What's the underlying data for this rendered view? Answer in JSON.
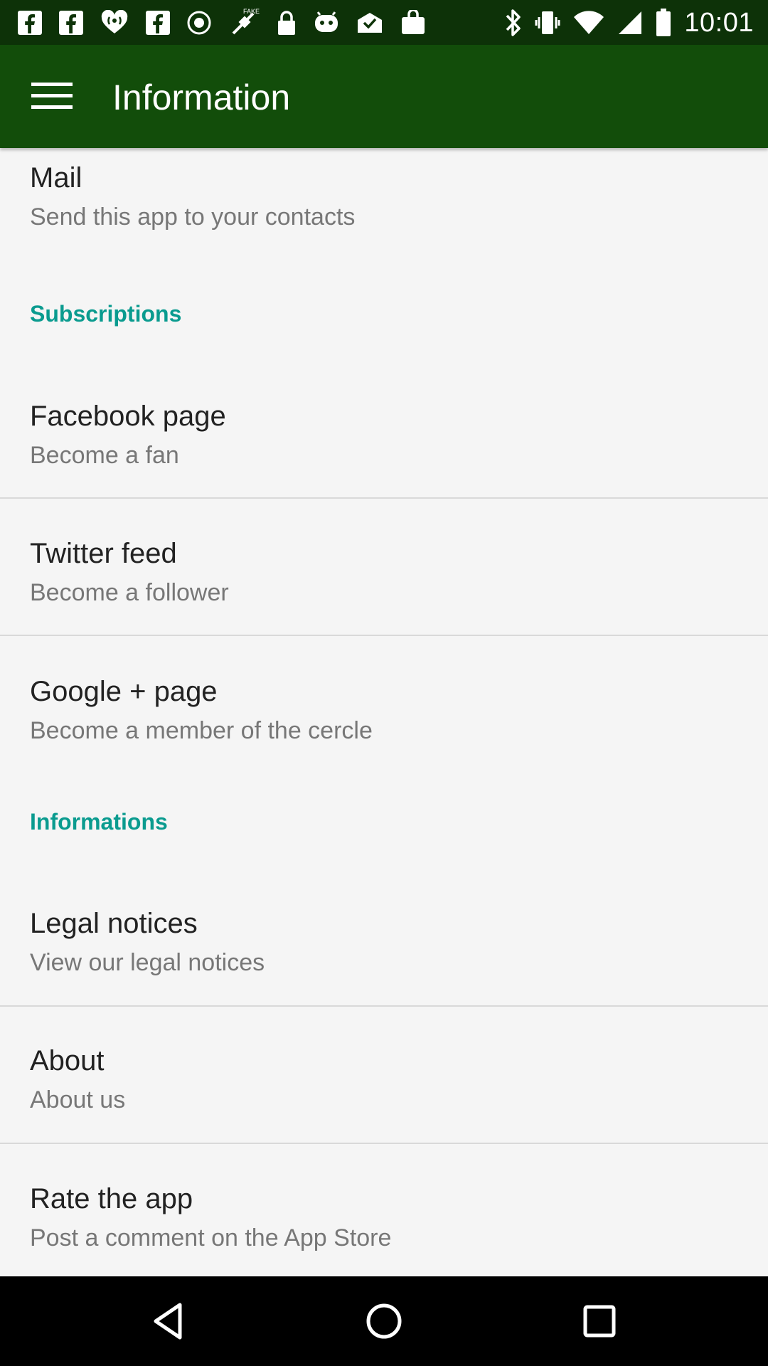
{
  "status_bar": {
    "time": "10:01",
    "left_icons": [
      "facebook-icon",
      "facebook-icon",
      "iheartradio-icon",
      "facebook-icon",
      "record-icon",
      "fake-gps-icon",
      "lock-icon",
      "game-icon",
      "mail-check-icon",
      "bag-icon"
    ],
    "right_icons": [
      "bluetooth-icon",
      "vibrate-icon",
      "wifi-icon",
      "signal-icon",
      "battery-icon"
    ]
  },
  "app_bar": {
    "title": "Information",
    "menu_icon": "hamburger-menu-icon",
    "color": "#124d0a"
  },
  "items": {
    "mail": {
      "title": "Mail",
      "subtitle": "Send this app to your contacts"
    },
    "facebook": {
      "title": "Facebook page",
      "subtitle": "Become a fan"
    },
    "twitter": {
      "title": "Twitter feed",
      "subtitle": "Become a follower"
    },
    "google": {
      "title": "Google + page",
      "subtitle": "Become a member of the cercle"
    },
    "legal": {
      "title": "Legal notices",
      "subtitle": "View our legal notices"
    },
    "about": {
      "title": "About",
      "subtitle": "About us"
    },
    "rate": {
      "title": "Rate the app",
      "subtitle": "Post a comment on the App Store"
    }
  },
  "sections": {
    "subscriptions": "Subscriptions",
    "informations": "Informations"
  },
  "accent_color": "#0a9b8f",
  "nav_bar": {
    "buttons": [
      "back-icon",
      "home-icon",
      "recents-icon"
    ]
  }
}
